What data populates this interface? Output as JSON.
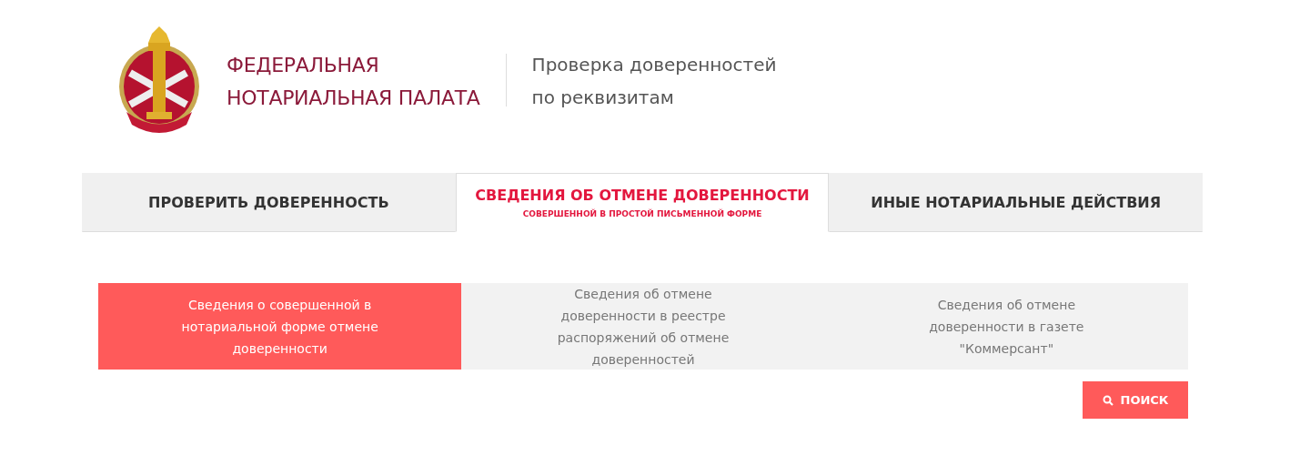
{
  "header": {
    "org_name": [
      "ФЕДЕРАЛЬНАЯ",
      "НОТАРИАЛЬНАЯ ПАЛАТА"
    ],
    "subtitle": [
      "Проверка доверенностей",
      "по реквизитам"
    ]
  },
  "tabs": [
    {
      "label": "ПРОВЕРИТЬ ДОВЕРЕННОСТЬ",
      "selected": false
    },
    {
      "label": "СВЕДЕНИЯ ОБ ОТМЕНЕ ДОВЕРЕННОСТИ",
      "sublabel": "СОВЕРШЕННОЙ В ПРОСТОЙ ПИСЬМЕННОЙ ФОРМЕ",
      "selected": true
    },
    {
      "label": "ИНЫЕ НОТАРИАЛЬНЫЕ ДЕЙСТВИЯ",
      "selected": false
    }
  ],
  "subtabs": [
    {
      "label": "Сведения о совершенной в нотариальной форме отмене доверенности",
      "selected": true
    },
    {
      "label": "Сведения об отмене доверенности в реестре распоряжений об отмене доверенностей",
      "selected": false
    },
    {
      "label": "Сведения об отмене доверенности в газете \"Коммерсант\"",
      "selected": false
    }
  ],
  "search_button": "ПОИСК"
}
